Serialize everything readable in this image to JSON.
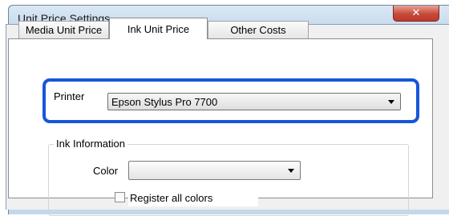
{
  "window": {
    "title": "Unit Price Settings",
    "close_glyph": "✕"
  },
  "tabs": [
    {
      "label": "Media Unit Price",
      "active": false
    },
    {
      "label": "Ink Unit Price",
      "active": true
    },
    {
      "label": "Other Costs",
      "active": false
    }
  ],
  "printer": {
    "label": "Printer",
    "selected": "Epson Stylus Pro 7700"
  },
  "ink_information": {
    "group_label": "Ink Information",
    "color_label": "Color",
    "color_selected": "",
    "register_all_colors_label": "Register all colors",
    "register_all_colors_checked": false
  },
  "colors": {
    "highlight": "#1756d8",
    "close_button": "#c7493a",
    "title_bar": "#c4d8ec"
  }
}
